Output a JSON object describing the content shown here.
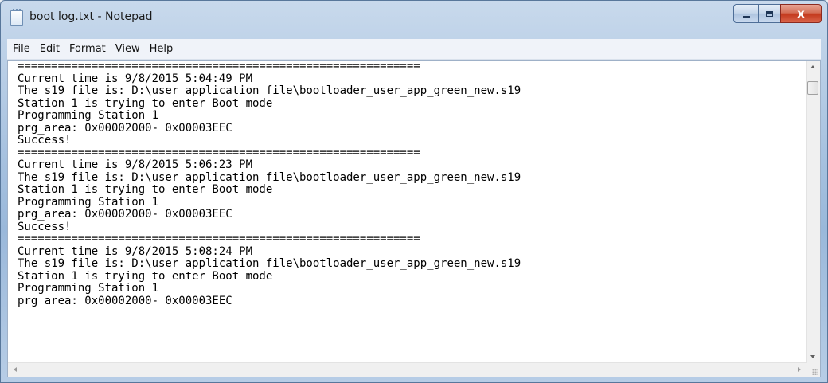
{
  "window": {
    "title": "boot log.txt - Notepad",
    "close_glyph": "x"
  },
  "menu": [
    "File",
    "Edit",
    "Format",
    "View",
    "Help"
  ],
  "content": {
    "lines": [
      "============================================================",
      "Current time is 9/8/2015 5:04:49 PM",
      "The s19 file is: D:\\user application file\\bootloader_user_app_green_new.s19",
      "Station 1 is trying to enter Boot mode",
      "Programming Station 1",
      "prg_area: 0x00002000- 0x00003EEC",
      "Success!",
      "============================================================",
      "Current time is 9/8/2015 5:06:23 PM",
      "The s19 file is: D:\\user application file\\bootloader_user_app_green_new.s19",
      "Station 1 is trying to enter Boot mode",
      "Programming Station 1",
      "prg_area: 0x00002000- 0x00003EEC",
      "Success!",
      "============================================================",
      "Current time is 9/8/2015 5:08:24 PM",
      "The s19 file is: D:\\user application file\\bootloader_user_app_green_new.s19",
      "Station 1 is trying to enter Boot mode",
      "Programming Station 1",
      "prg_area: 0x00002000- 0x00003EEC"
    ]
  },
  "icons": {
    "app": "notepad-icon",
    "minimize": "minimize-icon",
    "maximize": "maximize-icon",
    "close": "close-icon"
  },
  "colors": {
    "close_button": "#c43a1e",
    "titlebar": "#a9c3e0"
  }
}
